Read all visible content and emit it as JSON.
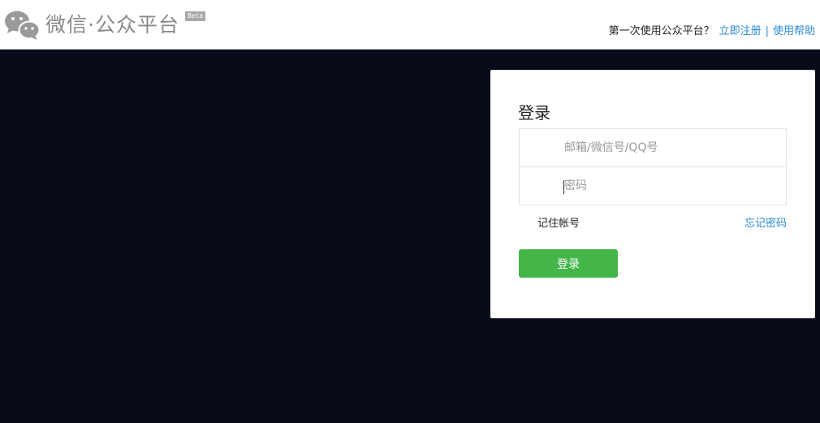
{
  "header": {
    "logo_text": "微信·公众平台",
    "beta_label": "Beta",
    "prompt_text": "第一次使用公众平台？",
    "register_link": "立即注册",
    "separator": "|",
    "help_link": "使用帮助"
  },
  "login": {
    "title": "登录",
    "account_placeholder": "邮箱/微信号/QQ号",
    "account_value": "",
    "password_placeholder": "密码",
    "password_value": "",
    "remember_label": "记住帐号",
    "forgot_link": "忘记密码",
    "submit_label": "登录"
  },
  "colors": {
    "page_background": "#080b19",
    "accent_green": "#44b549",
    "link_blue": "#2a8ad6",
    "logo_gray": "#8a8a8a"
  },
  "icons": {
    "logo": "wechat-logo-icon"
  }
}
